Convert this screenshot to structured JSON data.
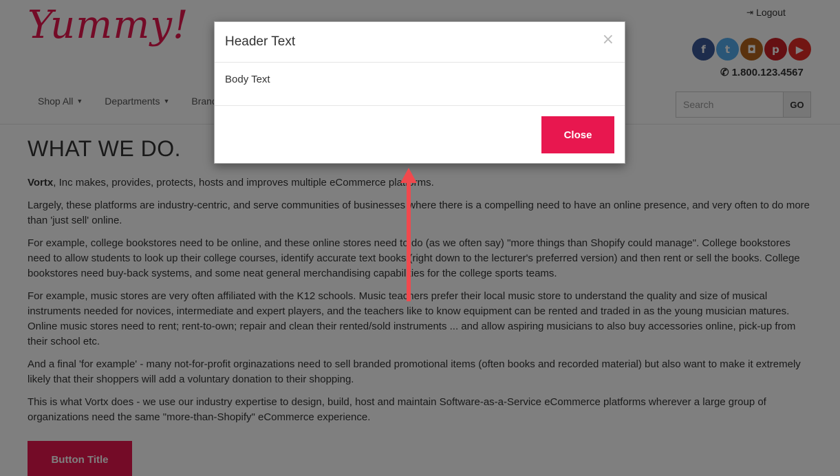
{
  "header": {
    "logo_text": "Yummy!",
    "logout_label": "Logout",
    "logout_icon": "sign-out-icon",
    "phone": "1.800.123.4567",
    "phone_icon": "phone-icon",
    "socials": [
      {
        "name": "facebook-icon",
        "glyph": "f",
        "color": "#3b5998"
      },
      {
        "name": "twitter-icon",
        "glyph": "t",
        "color": "#55acee"
      },
      {
        "name": "instagram-icon",
        "glyph": "◘",
        "color": "#b5651d"
      },
      {
        "name": "pinterest-icon",
        "glyph": "p",
        "color": "#cb2027"
      },
      {
        "name": "youtube-icon",
        "glyph": "▶",
        "color": "#e52d27"
      }
    ]
  },
  "nav": {
    "items": [
      "Shop All",
      "Departments",
      "Brands"
    ]
  },
  "search": {
    "placeholder": "Search",
    "go_label": "GO"
  },
  "content": {
    "title": "WHAT WE DO.",
    "intro_bold": "Vortx",
    "intro_rest": ", Inc makes, provides, protects, hosts and improves multiple eCommerce platforms.",
    "paragraphs": [
      "Largely, these platforms are industry-centric, and serve communities of businesses where there is a compelling need to have an online presence, and very often to do more than 'just sell' online.",
      "For example, college bookstores need to be online, and these online stores need to do (as we often say) \"more things than Shopify could manage\". College bookstores need to allow students to look up their college courses, identify accurate text books (right down to the lecturer's preferred version) and then rent or sell the books. College bookstores need buy-back systems, and some neat general merchandising capabilities for the college sports teams.",
      "For example, music stores are very often affiliated with the K12 schools. Music teachers prefer their local music store to understand the quality and size of musical instruments needed for novices, intermediate and expert players, and the teachers like to know equipment can be rented and traded in as the young musician matures. Online music stores need to rent; rent-to-own; repair and clean their rented/sold instruments ... and allow aspiring musicians to also buy accessories online, pick-up from their school etc.",
      "And a final 'for example' - many not-for-profit orginazations need to sell branded promotional items (often books and recorded material) but also want to make it extremely likely that their shoppers will add a voluntary donation to their shopping.",
      "This is what Vortx does - we use our industry expertise to design, build, host and maintain Software-as-a-Service eCommerce platforms wherever a large group of organizations need the same \"more-than-Shopify\" eCommerce experience."
    ],
    "button_label": "Button Title"
  },
  "modal": {
    "title": "Header Text",
    "close_x": "×",
    "body": "Body Text",
    "close_label": "Close"
  },
  "colors": {
    "brand": "#e8174f",
    "annotation_arrow": "#f0494d"
  }
}
